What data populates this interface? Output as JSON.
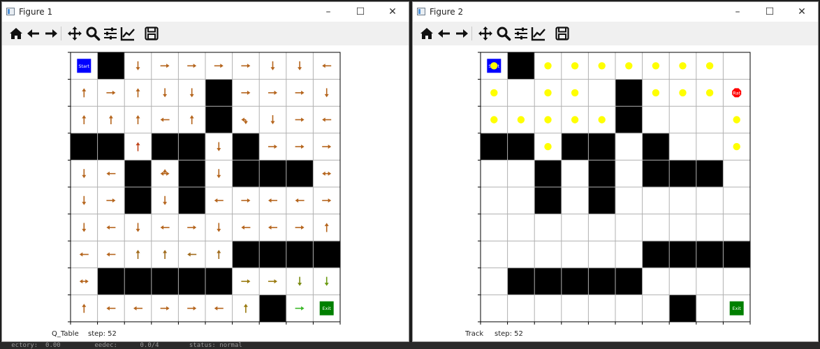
{
  "windows": [
    {
      "title": "Figure 1",
      "status_label": "Q_Table",
      "step_text": "step: 52",
      "controls": {
        "minimize": "–",
        "maximize": "☐",
        "close": "✕"
      },
      "toolbar": [
        "home-icon",
        "back-icon",
        "forward-icon",
        "pan-icon",
        "zoom-icon",
        "configure-subplots-icon",
        "edit-axis-icon",
        "save-icon"
      ]
    },
    {
      "title": "Figure 2",
      "status_label": "Track",
      "step_text": "step: 52",
      "controls": {
        "minimize": "–",
        "maximize": "☐",
        "close": "✕"
      },
      "toolbar": [
        "home-icon",
        "back-icon",
        "forward-icon",
        "pan-icon",
        "zoom-icon",
        "configure-subplots-icon",
        "edit-axis-icon",
        "save-icon"
      ]
    }
  ],
  "maze": {
    "rows": 10,
    "cols": 10,
    "walls": [
      [
        0,
        1
      ],
      [
        1,
        5
      ],
      [
        2,
        5
      ],
      [
        3,
        0
      ],
      [
        3,
        1
      ],
      [
        3,
        3
      ],
      [
        3,
        4
      ],
      [
        3,
        6
      ],
      [
        4,
        2
      ],
      [
        4,
        4
      ],
      [
        4,
        6
      ],
      [
        4,
        7
      ],
      [
        4,
        8
      ],
      [
        5,
        2
      ],
      [
        5,
        4
      ],
      [
        7,
        6
      ],
      [
        7,
        7
      ],
      [
        7,
        8
      ],
      [
        7,
        9
      ],
      [
        8,
        1
      ],
      [
        8,
        2
      ],
      [
        8,
        3
      ],
      [
        8,
        4
      ],
      [
        8,
        5
      ],
      [
        9,
        7
      ]
    ],
    "start_label": "Start",
    "exit_label": "Exit",
    "rat_label": "Rat",
    "colors": {
      "wall": "#000000",
      "start": "#0000ff",
      "exit": "#008000",
      "rat": "#ff0000",
      "track": "#ffff00",
      "grid": "#b0b0b0"
    }
  },
  "q_table_arrows": [
    {
      "r": 0,
      "c": 2,
      "d": "d",
      "col": "#b5651d"
    },
    {
      "r": 0,
      "c": 3,
      "d": "r",
      "col": "#b5651d"
    },
    {
      "r": 0,
      "c": 4,
      "d": "r",
      "col": "#b5651d"
    },
    {
      "r": 0,
      "c": 5,
      "d": "r",
      "col": "#b5651d"
    },
    {
      "r": 0,
      "c": 6,
      "d": "r",
      "col": "#b5651d"
    },
    {
      "r": 0,
      "c": 7,
      "d": "d",
      "col": "#b5651d"
    },
    {
      "r": 0,
      "c": 8,
      "d": "d",
      "col": "#b5651d"
    },
    {
      "r": 0,
      "c": 9,
      "d": "l",
      "col": "#b5651d"
    },
    {
      "r": 1,
      "c": 0,
      "d": "u",
      "col": "#b5651d"
    },
    {
      "r": 1,
      "c": 1,
      "d": "r",
      "col": "#b5651d"
    },
    {
      "r": 1,
      "c": 2,
      "d": "u",
      "col": "#b5651d"
    },
    {
      "r": 1,
      "c": 3,
      "d": "d",
      "col": "#b5651d"
    },
    {
      "r": 1,
      "c": 4,
      "d": "d",
      "col": "#b5651d"
    },
    {
      "r": 1,
      "c": 6,
      "d": "r",
      "col": "#b5651d"
    },
    {
      "r": 1,
      "c": 7,
      "d": "r",
      "col": "#b5651d"
    },
    {
      "r": 1,
      "c": 8,
      "d": "r",
      "col": "#b5651d"
    },
    {
      "r": 1,
      "c": 9,
      "d": "d",
      "col": "#b5651d"
    },
    {
      "r": 2,
      "c": 0,
      "d": "u",
      "col": "#b5651d"
    },
    {
      "r": 2,
      "c": 1,
      "d": "u",
      "col": "#b5651d"
    },
    {
      "r": 2,
      "c": 2,
      "d": "u",
      "col": "#b5651d"
    },
    {
      "r": 2,
      "c": 3,
      "d": "l",
      "col": "#b5651d"
    },
    {
      "r": 2,
      "c": 4,
      "d": "u",
      "col": "#b5651d"
    },
    {
      "r": 2,
      "c": 6,
      "d": "ld",
      "col": "#b5651d"
    },
    {
      "r": 2,
      "c": 7,
      "d": "d",
      "col": "#b5651d"
    },
    {
      "r": 2,
      "c": 8,
      "d": "r",
      "col": "#b5651d"
    },
    {
      "r": 2,
      "c": 9,
      "d": "l",
      "col": "#b5651d"
    },
    {
      "r": 3,
      "c": 2,
      "d": "u",
      "col": "#c0461d"
    },
    {
      "r": 3,
      "c": 5,
      "d": "d",
      "col": "#b5651d"
    },
    {
      "r": 3,
      "c": 7,
      "d": "r",
      "col": "#b5651d"
    },
    {
      "r": 3,
      "c": 8,
      "d": "r",
      "col": "#b5651d"
    },
    {
      "r": 3,
      "c": 9,
      "d": "r",
      "col": "#b5651d"
    },
    {
      "r": 4,
      "c": 0,
      "d": "d",
      "col": "#b5651d"
    },
    {
      "r": 4,
      "c": 1,
      "d": "l",
      "col": "#b5651d"
    },
    {
      "r": 4,
      "c": 3,
      "d": "ulr",
      "col": "#b5651d"
    },
    {
      "r": 4,
      "c": 5,
      "d": "d",
      "col": "#b5651d"
    },
    {
      "r": 4,
      "c": 9,
      "d": "lr",
      "col": "#b5651d"
    },
    {
      "r": 5,
      "c": 0,
      "d": "d",
      "col": "#b5651d"
    },
    {
      "r": 5,
      "c": 1,
      "d": "r",
      "col": "#b5651d"
    },
    {
      "r": 5,
      "c": 3,
      "d": "d",
      "col": "#b5651d"
    },
    {
      "r": 5,
      "c": 5,
      "d": "l",
      "col": "#b5651d"
    },
    {
      "r": 5,
      "c": 6,
      "d": "r",
      "col": "#b5651d"
    },
    {
      "r": 5,
      "c": 7,
      "d": "l",
      "col": "#b5651d"
    },
    {
      "r": 5,
      "c": 8,
      "d": "l",
      "col": "#b5651d"
    },
    {
      "r": 5,
      "c": 9,
      "d": "r",
      "col": "#b5651d"
    },
    {
      "r": 6,
      "c": 0,
      "d": "d",
      "col": "#b5651d"
    },
    {
      "r": 6,
      "c": 1,
      "d": "l",
      "col": "#b5651d"
    },
    {
      "r": 6,
      "c": 2,
      "d": "d",
      "col": "#b5651d"
    },
    {
      "r": 6,
      "c": 3,
      "d": "l",
      "col": "#b5651d"
    },
    {
      "r": 6,
      "c": 4,
      "d": "r",
      "col": "#b5651d"
    },
    {
      "r": 6,
      "c": 5,
      "d": "d",
      "col": "#b5651d"
    },
    {
      "r": 6,
      "c": 6,
      "d": "l",
      "col": "#b5651d"
    },
    {
      "r": 6,
      "c": 7,
      "d": "l",
      "col": "#b5651d"
    },
    {
      "r": 6,
      "c": 8,
      "d": "r",
      "col": "#b5651d"
    },
    {
      "r": 6,
      "c": 9,
      "d": "u",
      "col": "#b5651d"
    },
    {
      "r": 7,
      "c": 0,
      "d": "l",
      "col": "#b5651d"
    },
    {
      "r": 7,
      "c": 1,
      "d": "l",
      "col": "#b5651d"
    },
    {
      "r": 7,
      "c": 2,
      "d": "u",
      "col": "#a06a1a"
    },
    {
      "r": 7,
      "c": 3,
      "d": "u",
      "col": "#a06a1a"
    },
    {
      "r": 7,
      "c": 4,
      "d": "l",
      "col": "#a06a1a"
    },
    {
      "r": 7,
      "c": 5,
      "d": "u",
      "col": "#a06a1a"
    },
    {
      "r": 8,
      "c": 0,
      "d": "lr",
      "col": "#b5651d"
    },
    {
      "r": 8,
      "c": 6,
      "d": "r",
      "col": "#9a7a10"
    },
    {
      "r": 8,
      "c": 7,
      "d": "r",
      "col": "#9a7a10"
    },
    {
      "r": 8,
      "c": 8,
      "d": "d",
      "col": "#7a8a10"
    },
    {
      "r": 8,
      "c": 9,
      "d": "d",
      "col": "#6a9a10"
    },
    {
      "r": 9,
      "c": 0,
      "d": "u",
      "col": "#b5651d"
    },
    {
      "r": 9,
      "c": 1,
      "d": "l",
      "col": "#b5651d"
    },
    {
      "r": 9,
      "c": 2,
      "d": "l",
      "col": "#b5651d"
    },
    {
      "r": 9,
      "c": 3,
      "d": "r",
      "col": "#b5651d"
    },
    {
      "r": 9,
      "c": 4,
      "d": "r",
      "col": "#b5651d"
    },
    {
      "r": 9,
      "c": 5,
      "d": "l",
      "col": "#b5651d"
    },
    {
      "r": 9,
      "c": 6,
      "d": "u",
      "col": "#9a7a10"
    },
    {
      "r": 9,
      "c": 8,
      "d": "r",
      "col": "#3cb82a"
    }
  ],
  "track_cells": [
    [
      0,
      0
    ],
    [
      0,
      2
    ],
    [
      0,
      3
    ],
    [
      0,
      4
    ],
    [
      0,
      5
    ],
    [
      0,
      6
    ],
    [
      0,
      7
    ],
    [
      0,
      8
    ],
    [
      1,
      0
    ],
    [
      1,
      2
    ],
    [
      1,
      3
    ],
    [
      1,
      6
    ],
    [
      1,
      7
    ],
    [
      1,
      8
    ],
    [
      2,
      0
    ],
    [
      2,
      1
    ],
    [
      2,
      2
    ],
    [
      2,
      3
    ],
    [
      2,
      4
    ],
    [
      2,
      9
    ],
    [
      3,
      2
    ],
    [
      3,
      9
    ]
  ],
  "rat_position": [
    1,
    9
  ],
  "desktop_text": "   ectory:  0.00         eedec:      0.0/4        status: normal"
}
